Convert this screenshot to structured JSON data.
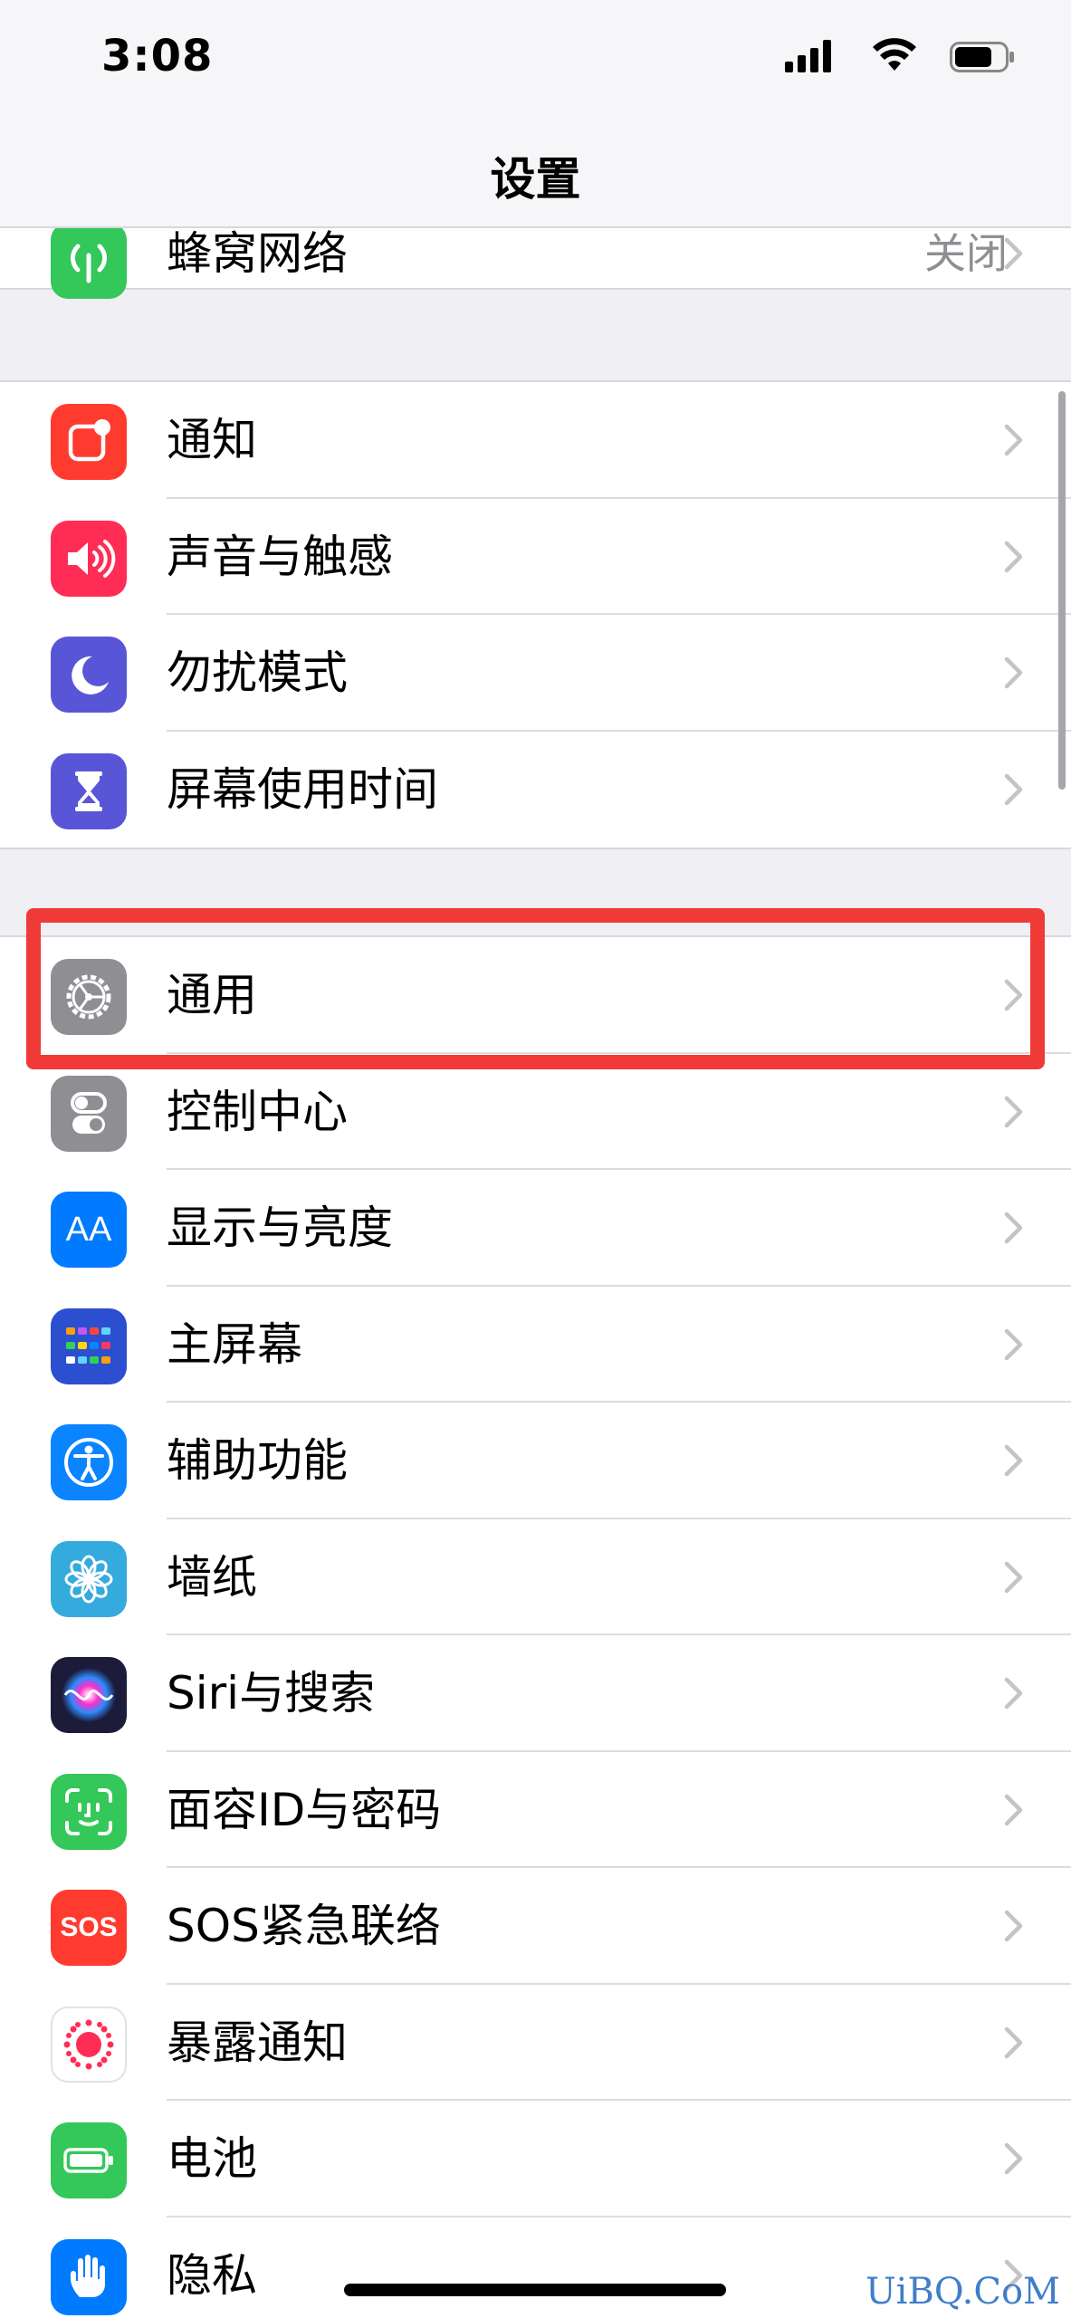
{
  "status_bar": {
    "time": "3:08"
  },
  "nav": {
    "title": "设置"
  },
  "partial_row": {
    "label": "蜂窝网络",
    "value": "关闭",
    "icon": "antenna-icon",
    "color": "#34c759"
  },
  "group1": [
    {
      "label": "通知",
      "icon": "notification-icon",
      "color": "#ff3b30"
    },
    {
      "label": "声音与触感",
      "icon": "speaker-icon",
      "color": "#ff2d55"
    },
    {
      "label": "勿扰模式",
      "icon": "moon-icon",
      "color": "#5856d6"
    },
    {
      "label": "屏幕使用时间",
      "icon": "hourglass-icon",
      "color": "#5856d6"
    }
  ],
  "group2": [
    {
      "label": "通用",
      "icon": "gear-icon",
      "color": "#8e8e93"
    },
    {
      "label": "控制中心",
      "icon": "toggles-icon",
      "color": "#8e8e93"
    },
    {
      "label": "显示与亮度",
      "icon": "aa-icon",
      "color": "#007aff"
    },
    {
      "label": "主屏幕",
      "icon": "home-grid-icon",
      "color": "#2c4fcf"
    },
    {
      "label": "辅助功能",
      "icon": "accessibility-icon",
      "color": "#0a84ff"
    },
    {
      "label": "墙纸",
      "icon": "flower-icon",
      "color": "#35aadc"
    },
    {
      "label": "Siri与搜索",
      "icon": "siri-icon",
      "color": "#1c1c3a"
    },
    {
      "label": "面容ID与密码",
      "icon": "faceid-icon",
      "color": "#34c759"
    },
    {
      "label": "SOS紧急联络",
      "icon": "sos-icon",
      "color": "#ff3b30"
    },
    {
      "label": "暴露通知",
      "icon": "exposure-icon",
      "color": "#ffffff"
    },
    {
      "label": "电池",
      "icon": "battery-icon",
      "color": "#34c759"
    },
    {
      "label": "隐私",
      "icon": "hand-icon",
      "color": "#007aff"
    }
  ],
  "icon_text": {
    "aa": "AA",
    "sos": "SOS"
  },
  "highlight_color": "#ef3a38",
  "watermark": "UiBQ.CoM"
}
